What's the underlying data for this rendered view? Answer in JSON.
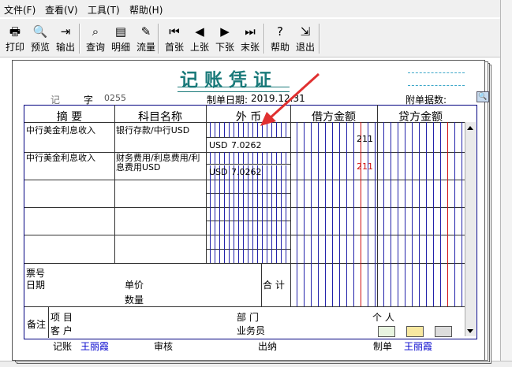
{
  "menu": [
    "文件(F)",
    "查看(V)",
    "工具(T)",
    "帮助(H)"
  ],
  "toolbar": [
    {
      "name": "print",
      "label": "打印",
      "icon": "printer-icon",
      "glyph": "🖶"
    },
    {
      "name": "preview",
      "label": "预览",
      "icon": "preview-icon",
      "glyph": "🔍"
    },
    {
      "name": "export",
      "label": "输出",
      "icon": "export-icon",
      "glyph": "⇥"
    },
    {
      "name": "query",
      "label": "查询",
      "icon": "binoculars-icon",
      "glyph": "⌕"
    },
    {
      "name": "detail",
      "label": "明细",
      "icon": "ledger-icon",
      "glyph": "▤"
    },
    {
      "name": "flow",
      "label": "流量",
      "icon": "pencil-icon",
      "glyph": "✎"
    },
    {
      "name": "first",
      "label": "首张",
      "icon": "first-icon",
      "glyph": "⏮"
    },
    {
      "name": "prev",
      "label": "上张",
      "icon": "prev-icon",
      "glyph": "◀"
    },
    {
      "name": "next",
      "label": "下张",
      "icon": "next-icon",
      "glyph": "▶"
    },
    {
      "name": "last",
      "label": "末张",
      "icon": "last-icon",
      "glyph": "⏭"
    },
    {
      "name": "help",
      "label": "帮助",
      "icon": "help-icon",
      "glyph": "?"
    },
    {
      "name": "exit",
      "label": "退出",
      "icon": "exit-icon",
      "glyph": "⇲"
    }
  ],
  "voucher": {
    "title": "记账凭证",
    "word_label": "记",
    "zi_label": "字",
    "number": "0255",
    "date_label": "制单日期:",
    "date": "2019.12.31",
    "attach_label": "附单据数:"
  },
  "columns": {
    "summary": "摘 要",
    "subject": "科目名称",
    "foreign": "外 币",
    "debit": "借方金额",
    "credit": "贷方金额"
  },
  "rows": [
    {
      "summary": "中行美金利息收入",
      "subject": "银行存款/中行USD",
      "currency": "USD",
      "rate": "7.0262",
      "amount": "211",
      "amount_color": "#000000"
    },
    {
      "summary": "中行美金利息收入",
      "subject": "财务费用/利息费用/利息费用USD",
      "currency": "USD",
      "rate": "7.0262",
      "amount": "211",
      "amount_color": "#d01010"
    }
  ],
  "bottom": {
    "ticket_label": "票号",
    "date_label": "日期",
    "price_label": "单价",
    "qty_label": "数量",
    "total_label": "合 计",
    "remark_label": "备注",
    "project_label": "项  目",
    "customer_label": "客  户",
    "dept_label": "部  门",
    "person_label": "个  人",
    "salesman_label": "业务员"
  },
  "footer": {
    "book_label": "记账",
    "book_name": "王丽霞",
    "audit_label": "审核",
    "cashier_label": "出纳",
    "maker_label": "制单",
    "maker_name": "王丽霞"
  },
  "colors": {
    "title": "#1a7a7a",
    "arrow": "#e03030",
    "grid": "#000080"
  }
}
